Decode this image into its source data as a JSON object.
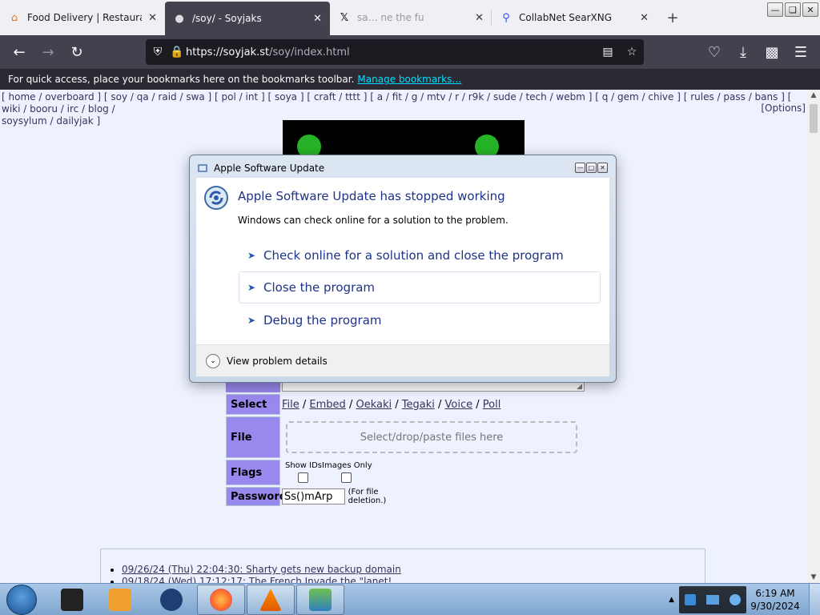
{
  "tabs": [
    {
      "title": "Food Delivery | Restaurant T",
      "icon": "restaurant-icon",
      "active": false
    },
    {
      "title": "/soy/ - Soyjaks",
      "icon": "soyjak-icon",
      "active": true
    },
    {
      "title": "sa… ne the fu",
      "icon": "x-logo-icon",
      "active": false
    },
    {
      "title": "CollabNet SearXNG",
      "icon": "search-icon",
      "active": false
    }
  ],
  "nav": {
    "url_host": "https://soyjak.st",
    "url_path": "/soy/index.html"
  },
  "bookmarks_bar": {
    "message": "For quick access, place your bookmarks here on the bookmarks toolbar.",
    "link": "Manage bookmarks…"
  },
  "boardlist": {
    "line1": "[ home / overboard ] [ soy / qa / raid / swa ] [ pol / int ] [ soya ] [ craft / tttt ] [ a / fit / g / mtv / r / r9k / sude / tech / webm ] [ q / gem / chive ] [ rules / pass / bans ] [ wiki / booru / irc / blog /",
    "line2": "soysylum / dailyjak ]",
    "options": "[Options]"
  },
  "form": {
    "select_label": "Select",
    "select_links": [
      "File",
      "Embed",
      "Oekaki",
      "Tegaki",
      "Voice",
      "Poll"
    ],
    "file_label": "File",
    "dropzone": "Select/drop/paste files here",
    "flags_label": "Flags",
    "flag_show_ids": "Show IDs",
    "flag_images_only": "Images Only",
    "password_label": "Password",
    "password_value": "Ss()mArp",
    "password_note": "(For file deletion.)"
  },
  "news": [
    "09/26/24 (Thu) 22:04:30: Sharty gets new backup domain",
    "09/18/24 (Wed) 17:12:17: The French Invade the \"lanet!"
  ],
  "dialog": {
    "title": "Apple Software Update",
    "heading": "Apple Software Update has stopped working",
    "subtext": "Windows can check online for a solution to the problem.",
    "options": [
      "Check online for a solution and close the program",
      "Close the program",
      "Debug the program"
    ],
    "details": "View problem details"
  },
  "taskbar": {
    "time": "6:19 AM",
    "date": "9/30/2024"
  },
  "colors": {
    "accent": "#1e3287",
    "board_bg": "#eef2ff",
    "label_bg": "#9988ee"
  }
}
